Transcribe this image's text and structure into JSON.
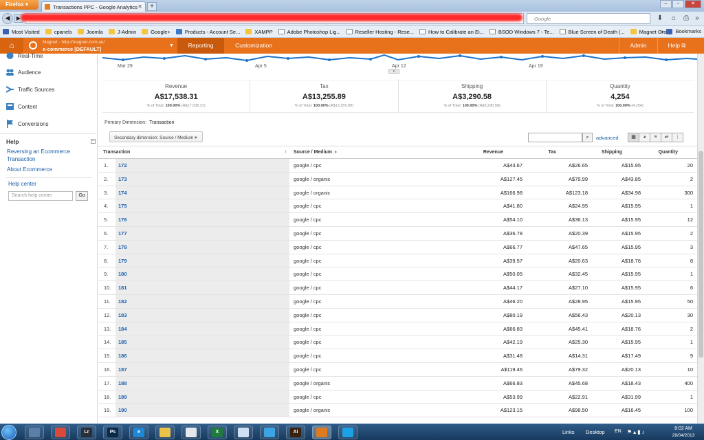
{
  "browser": {
    "firefox_label": "Firefox",
    "tab_title": "Transactions PPC - Google Analytics",
    "new_tab": "+",
    "search_placeholder": "Google",
    "bookmarks": [
      {
        "label": "Most Visited",
        "icon": "star-icon"
      },
      {
        "label": "cpanels",
        "icon": "folder-icon"
      },
      {
        "label": "Joomla",
        "icon": "folder-icon"
      },
      {
        "label": "J-Admin",
        "icon": "folder-icon"
      },
      {
        "label": "Google+",
        "icon": "folder-icon"
      },
      {
        "label": "Products - Account Se...",
        "icon": "page-icon"
      },
      {
        "label": "XAMPP",
        "icon": "folder-icon"
      },
      {
        "label": "Adobe Photoshop Lig...",
        "icon": "page-icon"
      },
      {
        "label": "Reseller Hosting - Rese...",
        "icon": "page-icon"
      },
      {
        "label": "How to Calibrate an Ei...",
        "icon": "page-icon"
      },
      {
        "label": "BSOD Windows 7 - Te...",
        "icon": "page-icon"
      },
      {
        "label": "Blue Screen of Death (...",
        "icon": "page-icon"
      },
      {
        "label": "Magnet Group",
        "icon": "folder-icon"
      }
    ],
    "bookmarks_right": "Bookmarks"
  },
  "ga_header": {
    "account_url": "Magnet - http://magnet.com.au/",
    "profile": "e-commerce [DEFAULT]",
    "reporting": "Reporting",
    "customization": "Customization",
    "admin": "Admin",
    "help": "Help"
  },
  "sidebar": {
    "items": [
      {
        "label": "Real-Time"
      },
      {
        "label": "Audience"
      },
      {
        "label": "Traffic Sources"
      },
      {
        "label": "Content"
      },
      {
        "label": "Conversions"
      }
    ],
    "help_title": "Help",
    "help_links": [
      "Reversing an Ecommerce",
      "Transaction",
      "About Ecommerce"
    ],
    "help_center": "Help center",
    "search_placeholder": "Search help center",
    "go": "Go"
  },
  "trend": {
    "dates": [
      "Mar 29",
      "Apr 5",
      "Apr 12",
      "Apr 19"
    ],
    "line_color": "#1a73c9"
  },
  "summary": [
    {
      "label": "Revenue",
      "value": "A$17,538.31",
      "pct_prefix": "% of Total:",
      "pct": "100.00%",
      "total": "(A$17,538.31)"
    },
    {
      "label": "Tax",
      "value": "A$13,255.89",
      "pct_prefix": "% of Total:",
      "pct": "100.00%",
      "total": "(A$13,255.89)"
    },
    {
      "label": "Shipping",
      "value": "A$3,290.58",
      "pct_prefix": "% of Total:",
      "pct": "100.00%",
      "total": "(A$3,290.58)"
    },
    {
      "label": "Quantity",
      "value": "4,254",
      "pct_prefix": "% of Total:",
      "pct": "100.00%",
      "total": "(4,254)"
    }
  ],
  "controls": {
    "primary_label": "Primary Dimension:",
    "primary_value": "Transaction",
    "secondary": "Secondary dimension: Source / Medium",
    "advanced": "advanced"
  },
  "table": {
    "headers": {
      "transaction": "Transaction",
      "source": "Source / Medium",
      "revenue": "Revenue",
      "tax": "Tax",
      "shipping": "Shipping",
      "quantity": "Quantity"
    },
    "rows": [
      {
        "idx": "1.",
        "txn": "172",
        "src": "google / cpc",
        "rev": "A$43.67",
        "tax": "A$26.65",
        "shp": "A$15.95",
        "qty": "20"
      },
      {
        "idx": "2.",
        "txn": "173",
        "src": "google / organic",
        "rev": "A$127.45",
        "tax": "A$79.99",
        "shp": "A$43.85",
        "qty": "2"
      },
      {
        "idx": "3.",
        "txn": "174",
        "src": "google / organic",
        "rev": "A$166.98",
        "tax": "A$123.18",
        "shp": "A$34.98",
        "qty": "300"
      },
      {
        "idx": "4.",
        "txn": "175",
        "src": "google / cpc",
        "rev": "A$41.80",
        "tax": "A$24.95",
        "shp": "A$15.95",
        "qty": "1"
      },
      {
        "idx": "5.",
        "txn": "176",
        "src": "google / cpc",
        "rev": "A$54.10",
        "tax": "A$36.13",
        "shp": "A$15.95",
        "qty": "12"
      },
      {
        "idx": "6.",
        "txn": "177",
        "src": "google / cpc",
        "rev": "A$36.78",
        "tax": "A$20.39",
        "shp": "A$15.95",
        "qty": "2"
      },
      {
        "idx": "7.",
        "txn": "178",
        "src": "google / cpc",
        "rev": "A$66.77",
        "tax": "A$47.65",
        "shp": "A$15.95",
        "qty": "3"
      },
      {
        "idx": "8.",
        "txn": "179",
        "src": "google / cpc",
        "rev": "A$39.57",
        "tax": "A$20.63",
        "shp": "A$18.76",
        "qty": "8"
      },
      {
        "idx": "9.",
        "txn": "180",
        "src": "google / cpc",
        "rev": "A$50.05",
        "tax": "A$32.45",
        "shp": "A$15.95",
        "qty": "1"
      },
      {
        "idx": "10.",
        "txn": "181",
        "src": "google / cpc",
        "rev": "A$44.17",
        "tax": "A$27.10",
        "shp": "A$15.95",
        "qty": "6"
      },
      {
        "idx": "11.",
        "txn": "182",
        "src": "google / cpc",
        "rev": "A$46.20",
        "tax": "A$28.95",
        "shp": "A$15.95",
        "qty": "50"
      },
      {
        "idx": "12.",
        "txn": "183",
        "src": "google / cpc",
        "rev": "A$80.19",
        "tax": "A$56.43",
        "shp": "A$20.13",
        "qty": "30"
      },
      {
        "idx": "13.",
        "txn": "184",
        "src": "google / cpc",
        "rev": "A$66.83",
        "tax": "A$45.41",
        "shp": "A$18.76",
        "qty": "2"
      },
      {
        "idx": "14.",
        "txn": "185",
        "src": "google / cpc",
        "rev": "A$42.19",
        "tax": "A$25.30",
        "shp": "A$15.95",
        "qty": "1"
      },
      {
        "idx": "15.",
        "txn": "186",
        "src": "google / cpc",
        "rev": "A$31.48",
        "tax": "A$14.31",
        "shp": "A$17.49",
        "qty": "9"
      },
      {
        "idx": "16.",
        "txn": "187",
        "src": "google / cpc",
        "rev": "A$119.46",
        "tax": "A$79.32",
        "shp": "A$20.13",
        "qty": "10"
      },
      {
        "idx": "17.",
        "txn": "188",
        "src": "google / organic",
        "rev": "A$66.83",
        "tax": "A$45.68",
        "shp": "A$18.43",
        "qty": "400"
      },
      {
        "idx": "18.",
        "txn": "189",
        "src": "google / cpc",
        "rev": "A$53.99",
        "tax": "A$22.91",
        "shp": "A$31.99",
        "qty": "1"
      },
      {
        "idx": "19.",
        "txn": "190",
        "src": "google / organic",
        "rev": "A$123.15",
        "tax": "A$98.50",
        "shp": "A$16.45",
        "qty": "100"
      }
    ]
  },
  "taskbar": {
    "apps": [
      {
        "name": "explorer-window",
        "label": ""
      },
      {
        "name": "chrome",
        "label": ""
      },
      {
        "name": "lightroom",
        "label": "Lr"
      },
      {
        "name": "photoshop",
        "label": "Ps"
      },
      {
        "name": "internet-explorer",
        "label": "e"
      },
      {
        "name": "file-explorer",
        "label": ""
      },
      {
        "name": "media-player",
        "label": ""
      },
      {
        "name": "excel",
        "label": "X"
      },
      {
        "name": "notepad",
        "label": ""
      },
      {
        "name": "twitter",
        "label": ""
      },
      {
        "name": "illustrator",
        "label": "Ai"
      },
      {
        "name": "firefox",
        "label": ""
      },
      {
        "name": "skype",
        "label": ""
      }
    ],
    "links": "Links",
    "desktop": "Desktop",
    "lang": "EN",
    "time": "8:02 AM",
    "date": "28/04/2013"
  }
}
